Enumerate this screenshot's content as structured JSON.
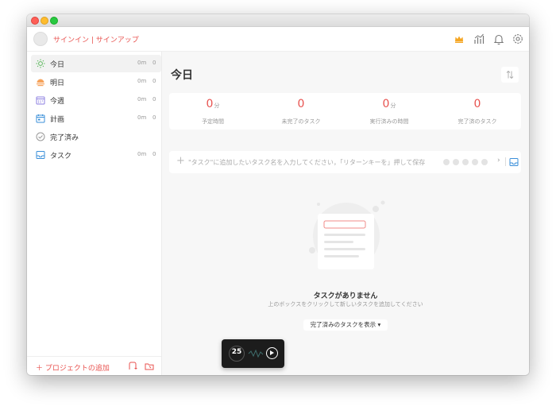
{
  "header": {
    "signin_label": "サインイン | サインアップ",
    "icons": [
      "crown-icon",
      "stats-icon",
      "bell-icon",
      "settings-icon"
    ]
  },
  "sidebar": {
    "items": [
      {
        "label": "今日",
        "time": "0m",
        "count": "0",
        "icon": "sun-icon",
        "active": true
      },
      {
        "label": "明日",
        "time": "0m",
        "count": "0",
        "icon": "sunset-icon"
      },
      {
        "label": "今週",
        "time": "0m",
        "count": "0",
        "icon": "calendar-week-icon"
      },
      {
        "label": "計画",
        "time": "0m",
        "count": "0",
        "icon": "calendar-plan-icon"
      },
      {
        "label": "完了済み",
        "time": "",
        "count": "",
        "icon": "check-circle-icon"
      },
      {
        "label": "タスク",
        "time": "0m",
        "count": "0",
        "icon": "inbox-icon"
      }
    ],
    "add_project_label": "＋ プロジェクトの追加"
  },
  "main": {
    "title": "今日",
    "stats": [
      {
        "value": "0",
        "unit": "分",
        "label": "予定時間"
      },
      {
        "value": "0",
        "unit": "",
        "label": "未完了のタスク"
      },
      {
        "value": "0",
        "unit": "分",
        "label": "実行済みの時間"
      },
      {
        "value": "0",
        "unit": "",
        "label": "完了済のタスク"
      }
    ],
    "add_task_placeholder": "\"タスク\"に追加したいタスク名を入力してください，「リターンキーを」押して保存",
    "empty_title": "タスクがありません",
    "empty_subtitle": "上のボックスをクリックして新しいタスクを追加してください",
    "show_completed_label": "完了済みのタスクを表示 ▾"
  },
  "pomodoro": {
    "minutes": "25"
  },
  "colors": {
    "accent": "#e8524f",
    "sidebar_active": "#f2f2f2",
    "main_bg": "#f7f7f7"
  }
}
